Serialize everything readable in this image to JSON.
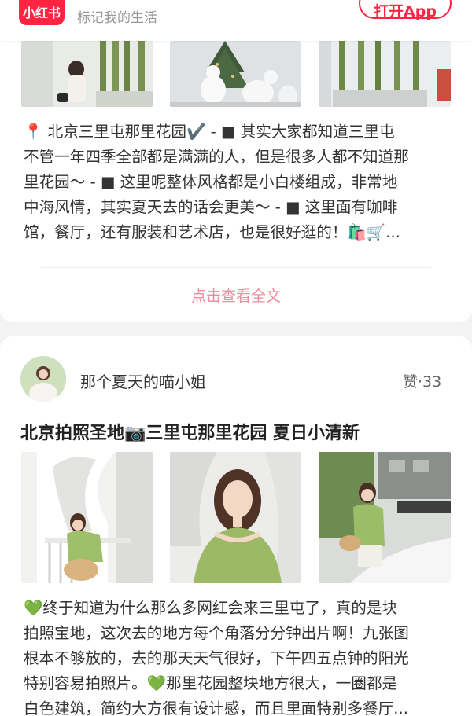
{
  "appbar": {
    "logo_text": "小红书",
    "slogan": "标记我的生活",
    "open_app_label": "打开App"
  },
  "post1": {
    "lines": [
      "📍 北京三里屯那里花园✔️ - ■ 其实大家都知道三里屯",
      "不管一年四季全部都是满满的人，但是很多人都不知道那",
      "里花园～ - ■ 这里呢整体风格都是小白楼组成，非常地",
      "中海风情，其实夏天去的话会更美～ - ■ 这里面有咖啡",
      "馆，餐厅，还有服装和艺术店，也是很好逛的！🛍️🛒..."
    ],
    "read_more_label": "点击查看全文"
  },
  "post2": {
    "author_name": "那个夏天的喵小姐",
    "likes_label": "赞·33",
    "title": "北京拍照圣地📷三里屯那里花园 夏日小清新",
    "lines": [
      "💚终于知道为什么那么多网红会来三里屯了，真的是块",
      "拍照宝地，这次去的地方每个角落分分钟出片啊！九张图",
      "根本不够放的，去的那天天气很好，下午四五点钟的阳光",
      "特别容易拍照片。💚那里花园整块地方很大，一圈都是",
      "白色建筑，简约大方很有设计感，而且里面特别多餐厅..."
    ]
  },
  "colors": {
    "brand_red": "#ff2442",
    "read_more_pink": "#f08aa0"
  }
}
